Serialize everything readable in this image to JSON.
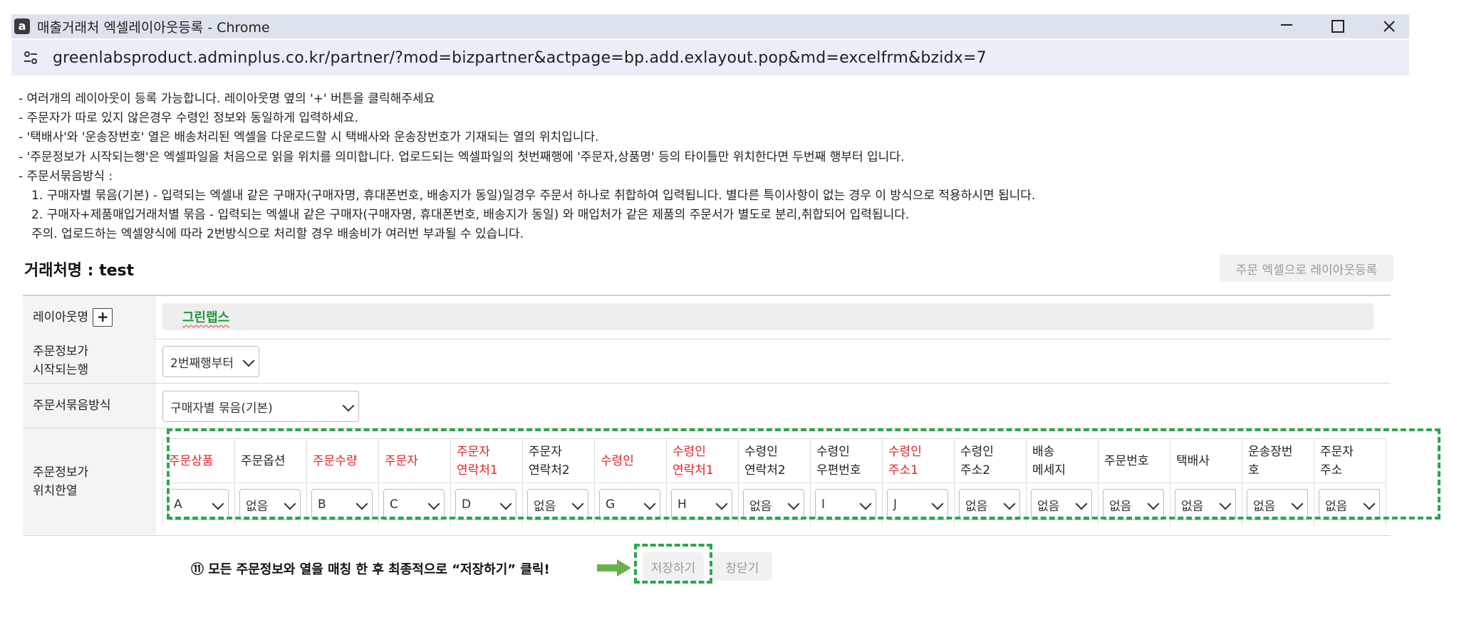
{
  "window": {
    "app_icon_letter": "a",
    "title": "매출거래처 엑셀레이아웃등록 - Chrome",
    "url": "greenlabsproduct.adminplus.co.kr/partner/?mod=bizpartner&actpage=bp.add.exlayout.pop&md=excelfrm&bzidx=7"
  },
  "notes": [
    "- 여러개의 레이아웃이 등록 가능합니다. 레이아웃명 옆의 '+' 버튼을 클릭해주세요",
    "- 주문자가 따로 있지 않은경우 수령인 정보와 동일하게 입력하세요.",
    "- '택배사'와 '운송장번호' 열은 배송처리된 엑셀을 다운로드할 시 택배사와 운송장번호가 기재되는 열의 위치입니다.",
    "- '주문정보가 시작되는행'은 엑셀파일을 처음으로 읽을 위치를 의미합니다. 업로드되는 엑셀파일의 첫번째행에 '주문자,상품명' 등의 타이틀만 위치한다면 두번째 행부터 입니다.",
    "- 주문서묶음방식 :",
    "1. 구매자별 묶음(기본) - 입력되는 엑셀내 같은 구매자(구매자명, 휴대폰번호, 배송지가 동일)일경우 주문서 하나로 취합하여 입력됩니다. 별다른 특이사항이 없는 경우 이 방식으로 적용하시면 됩니다.",
    "2. 구매자+제품매입거래처별 묶음 - 입력되는 엑셀내 같은 구매자(구매자명, 휴대폰번호, 배송지가 동일) 와 매입처가 같은 제품의 주문서가 별도로 분리,취합되어 입력됩니다.",
    "주의. 업로드하는 엑셀양식에 따라 2번방식으로 처리할 경우 배송비가 여러번 부과될 수 있습니다."
  ],
  "partner_title": "거래처명 : test",
  "register_button": "주문 엑셀으로 레이아웃등록",
  "form": {
    "layout_name_label": "레이아웃명",
    "plus_label": "+",
    "layout_name_value": "그린랩스",
    "start_row_label_1": "주문정보가",
    "start_row_label_2": "시작되는행",
    "start_row_value": "2번째행부터",
    "bundle_label": "주문서묶음방식",
    "bundle_value": "구매자별 묶음(기본)",
    "position_label_1": "주문정보가",
    "position_label_2": "위치한열"
  },
  "columns": [
    {
      "line1": "주문상품",
      "line2": "",
      "required": true,
      "value": "A"
    },
    {
      "line1": "주문옵션",
      "line2": "",
      "required": false,
      "value": "없음"
    },
    {
      "line1": "주문수량",
      "line2": "",
      "required": true,
      "value": "B"
    },
    {
      "line1": "주문자",
      "line2": "",
      "required": true,
      "value": "C"
    },
    {
      "line1": "주문자",
      "line2": "연락처1",
      "required": true,
      "value": "D"
    },
    {
      "line1": "주문자",
      "line2": "연락처2",
      "required": false,
      "value": "없음"
    },
    {
      "line1": "수령인",
      "line2": "",
      "required": true,
      "value": "G"
    },
    {
      "line1": "수령인",
      "line2": "연락처1",
      "required": true,
      "value": "H"
    },
    {
      "line1": "수령인",
      "line2": "연락처2",
      "required": false,
      "value": "없음"
    },
    {
      "line1": "수령인",
      "line2": "우편번호",
      "required": false,
      "value": "I"
    },
    {
      "line1": "수령인",
      "line2": "주소1",
      "required": true,
      "value": "J"
    },
    {
      "line1": "수령인",
      "line2": "주소2",
      "required": false,
      "value": "없음"
    },
    {
      "line1": "배송",
      "line2": "메세지",
      "required": false,
      "value": "없음"
    },
    {
      "line1": "주문번호",
      "line2": "",
      "required": false,
      "value": "없음"
    },
    {
      "line1": "택배사",
      "line2": "",
      "required": false,
      "value": "없음"
    },
    {
      "line1": "운송장번",
      "line2": "호",
      "required": false,
      "value": "없음"
    },
    {
      "line1": "주문자",
      "line2": "주소",
      "required": false,
      "value": "없음"
    }
  ],
  "instruction": "⑪ 모든 주문정보와 열을 매칭 한 후 최종적으로 “저장하기” 클릭!",
  "buttons": {
    "save": "저장하기",
    "close": "창닫기"
  },
  "colors": {
    "required": "#e02424",
    "highlight": "#2aa84a",
    "layout_name": "#1a9b3a"
  }
}
